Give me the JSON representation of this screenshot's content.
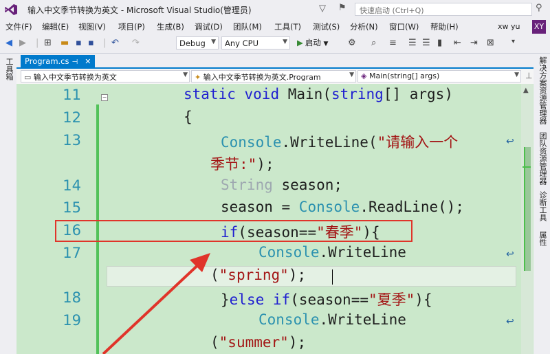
{
  "window": {
    "title": "输入中文季节转换为英文 - Microsoft Visual Studio(管理员)",
    "quick_launch_placeholder": "快速启动 (Ctrl+Q)",
    "user_name": "xw yu",
    "user_initials": "XY"
  },
  "menu": [
    "文件(F)",
    "编辑(E)",
    "视图(V)",
    "项目(P)",
    "生成(B)",
    "调试(D)",
    "团队(M)",
    "工具(T)",
    "测试(S)",
    "分析(N)",
    "窗口(W)",
    "帮助(H)"
  ],
  "toolbar": {
    "configuration": "Debug",
    "platform": "Any CPU",
    "start_label": "启动"
  },
  "left_strip": {
    "toolbox": "工具箱"
  },
  "right_strip": [
    "解决方案资源管理器",
    "团队资源管理器",
    "诊断工具",
    "属性"
  ],
  "tab": {
    "label": "Program.cs"
  },
  "nav": {
    "project": "输入中文季节转换为英文",
    "class": "输入中文季节转换为英文.Program",
    "member": "Main(string[] args)"
  },
  "code": {
    "line_numbers": [
      "11",
      "12",
      "13",
      "14",
      "15",
      "16",
      "17",
      "18",
      "19"
    ],
    "l11_kw1": "static",
    "l11_kw2": "void",
    "l11_name": "Main(",
    "l11_type": "string",
    "l11_rest": "[] args)",
    "l12": "{",
    "l13_type": "Console",
    "l13_mid": ".WriteLine(",
    "l13_str": "\"请输入一个",
    "l13b_str": "季节:\"",
    "l13b_rest": ");",
    "l14_type": "String",
    "l14_rest": " season;",
    "l15_a": "season = ",
    "l15_type": "Console",
    "l15_rest": ".ReadLine();",
    "l16_kw": "if",
    "l16_mid": "(season==",
    "l16_str": "\"春季\"",
    "l16_rest": "){",
    "l17_type": "Console",
    "l17_rest": ".WriteLine",
    "l17b_a": "(",
    "l17b_str": "\"spring\"",
    "l17b_rest": ");",
    "l18_a": "}",
    "l18_kw1": "else",
    "l18_kw2": "if",
    "l18_mid": "(season==",
    "l18_str": "\"夏季\"",
    "l18_rest": "){",
    "l19_type": "Console",
    "l19_rest": ".WriteLine",
    "l19b_a": "(",
    "l19b_str": "\"summer\"",
    "l19b_rest": ");"
  },
  "colors": {
    "editor_bg": "#cbe8cb",
    "accent": "#007acc",
    "keyword": "#1f1fd0",
    "type": "#2b91af",
    "string": "#a31515",
    "annotation_red": "#e0342a"
  }
}
